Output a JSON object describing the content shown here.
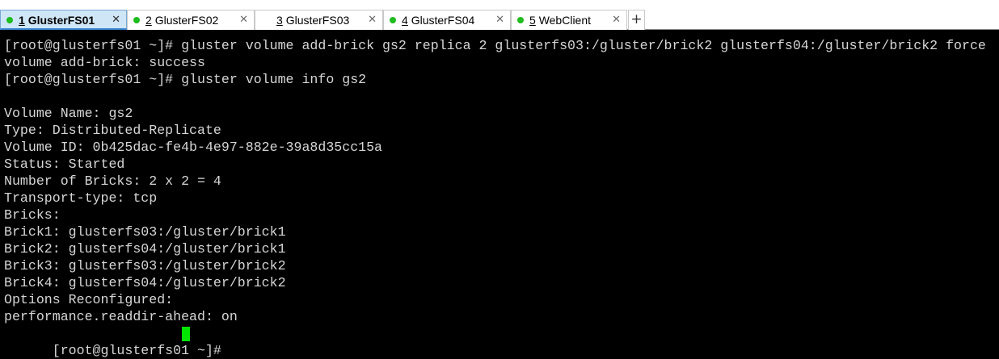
{
  "tabs": [
    {
      "num": "1",
      "name": "GlusterFS01",
      "active": true,
      "has_close": true
    },
    {
      "num": "2",
      "name": "GlusterFS02",
      "active": false,
      "has_close": true
    },
    {
      "num": "3",
      "name": "GlusterFS03",
      "active": false,
      "has_close": true
    },
    {
      "num": "4",
      "name": "GlusterFS04",
      "active": false,
      "has_close": true
    },
    {
      "num": "5",
      "name": "WebClient",
      "active": false,
      "has_close": true
    }
  ],
  "icons": {
    "tab_status": "green-dot-icon",
    "tab_close": "close-icon",
    "new_tab": "plus-icon"
  },
  "colors": {
    "terminal_background": "#000000",
    "terminal_text": "#d6d6d6",
    "cursor": "#00e600",
    "status_dot": "#1fbd1f",
    "active_tab_background": "#cfe6f7"
  },
  "terminal": {
    "lines": [
      "[root@glusterfs01 ~]# gluster volume add-brick gs2 replica 2 glusterfs03:/gluster/brick2 glusterfs04:/gluster/brick2 force",
      "volume add-brick: success",
      "[root@glusterfs01 ~]# gluster volume info gs2",
      "",
      "Volume Name: gs2",
      "Type: Distributed-Replicate",
      "Volume ID: 0b425dac-fe4b-4e97-882e-39a8d35cc15a",
      "Status: Started",
      "Number of Bricks: 2 x 2 = 4",
      "Transport-type: tcp",
      "Bricks:",
      "Brick1: glusterfs03:/gluster/brick1",
      "Brick2: glusterfs04:/gluster/brick1",
      "Brick3: glusterfs03:/gluster/brick2",
      "Brick4: glusterfs04:/gluster/brick2",
      "Options Reconfigured:",
      "performance.readdir-ahead: on"
    ],
    "prompt": "[root@glusterfs01 ~]# "
  }
}
